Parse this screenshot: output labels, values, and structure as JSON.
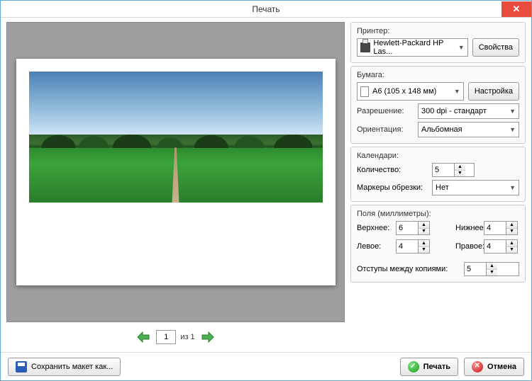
{
  "window": {
    "title": "Печать"
  },
  "printer": {
    "section_label": "Принтер:",
    "selected": "Hewlett-Packard HP Las...",
    "properties_btn": "Свойства"
  },
  "paper": {
    "section_label": "Бумага:",
    "selected": "A6 (105 x 148 мм)",
    "setup_btn": "Настройка",
    "resolution_label": "Разрешение:",
    "resolution_value": "300 dpi - стандарт",
    "orientation_label": "Ориентация:",
    "orientation_value": "Альбомная"
  },
  "calendars": {
    "section_label": "Календари:",
    "count_label": "Количество:",
    "count_value": "5",
    "crop_label": "Маркеры обрезки:",
    "crop_value": "Нет"
  },
  "margins": {
    "section_label": "Поля (миллиметры):",
    "top_label": "Верхнее:",
    "top_value": "6",
    "bottom_label": "Нижнее:",
    "bottom_value": "4",
    "left_label": "Левое:",
    "left_value": "4",
    "right_label": "Правое:",
    "right_value": "4",
    "gap_label": "Отступы между копиями:",
    "gap_value": "5"
  },
  "pager": {
    "current": "1",
    "of_text": "из 1"
  },
  "footer": {
    "save_layout": "Сохранить макет как...",
    "print": "Печать",
    "cancel": "Отмена"
  }
}
